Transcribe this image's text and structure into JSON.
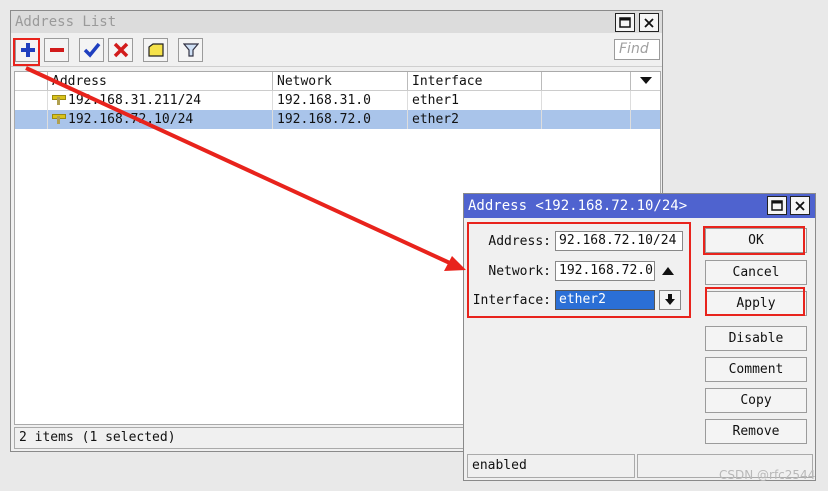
{
  "main_window": {
    "title": "Address List",
    "find_placeholder": "Find",
    "columns": [
      "Address",
      "Network",
      "Interface"
    ],
    "rows": [
      {
        "address": "192.168.31.211/24",
        "network": "192.168.31.0",
        "interface": "ether1",
        "selected": false
      },
      {
        "address": "192.168.72.10/24",
        "network": "192.168.72.0",
        "interface": "ether2",
        "selected": true
      }
    ],
    "status": "2 items (1 selected)",
    "toolbar_icons": [
      "add-icon",
      "remove-icon",
      "enable-icon",
      "disable-icon",
      "comment-icon",
      "filter-icon"
    ]
  },
  "dialog": {
    "title": "Address <192.168.72.10/24>",
    "address_label": "Address:",
    "address_value": "92.168.72.10/24",
    "network_label": "Network:",
    "network_value": "192.168.72.0",
    "interface_label": "Interface:",
    "interface_value": "ether2",
    "buttons": {
      "ok": "OK",
      "cancel": "Cancel",
      "apply": "Apply",
      "disable": "Disable",
      "comment": "Comment",
      "copy": "Copy",
      "remove": "Remove"
    },
    "status": "enabled"
  },
  "watermark": "CSDN @rfc2544",
  "colors": {
    "selection": "#a9c4ea",
    "dialog_title": "#4f63cf",
    "annotation_red": "#e8231c",
    "add_blue": "#1f3fbf"
  }
}
